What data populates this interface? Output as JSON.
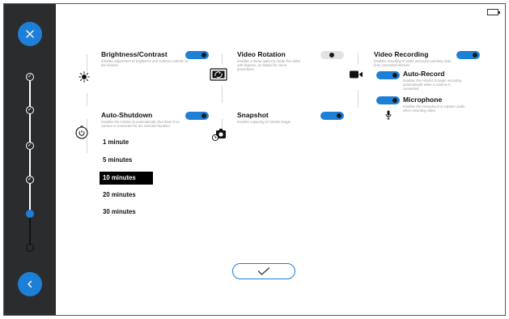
{
  "sidebar": {
    "close_icon": "close-icon",
    "back_icon": "chevron-left-icon",
    "steps": [
      "done",
      "done",
      "done",
      "done",
      "current",
      "future"
    ]
  },
  "settings": {
    "brightness": {
      "title": "Brightness/Contrast",
      "desc": "Enables adjustment of brightness and contrast controls on the monitor.",
      "enabled": true,
      "icon": "sun-icon"
    },
    "rotation": {
      "title": "Video Rotation",
      "desc": "Enables a menu option to rotate live video 180 degrees, as helpful for some procedures.",
      "enabled": false,
      "icon": "rotate-screen-icon"
    },
    "recording": {
      "title": "Video Recording",
      "desc": "Enables recording of video and pulse oximetry data from connected devices.",
      "enabled": true,
      "icon": "video-camera-icon"
    },
    "auto_record": {
      "title": "Auto-Record",
      "desc": "Enables the monitor to begin recording automatically when a camera is connected.",
      "enabled": true
    },
    "microphone": {
      "title": "Microphone",
      "desc": "Enables the microphone to capture audio when recording video.",
      "enabled": true,
      "icon": "microphone-icon"
    },
    "auto_shutdown": {
      "title": "Auto-Shutdown",
      "desc": "Enables the monitor to automatically shut down if no camera is connected for the selected duration.",
      "enabled": true,
      "icon": "power-timer-icon"
    },
    "snapshot": {
      "title": "Snapshot",
      "desc": "Enables capturing of monitor image.",
      "enabled": true,
      "icon": "camera-timer-icon"
    }
  },
  "shutdown_options": [
    "1 minute",
    "5 minutes",
    "10 minutes",
    "20 minutes",
    "30 minutes"
  ],
  "shutdown_selected": "10 minutes",
  "accent_color": "#1e7fd6",
  "confirm_icon": "checkmark-icon"
}
